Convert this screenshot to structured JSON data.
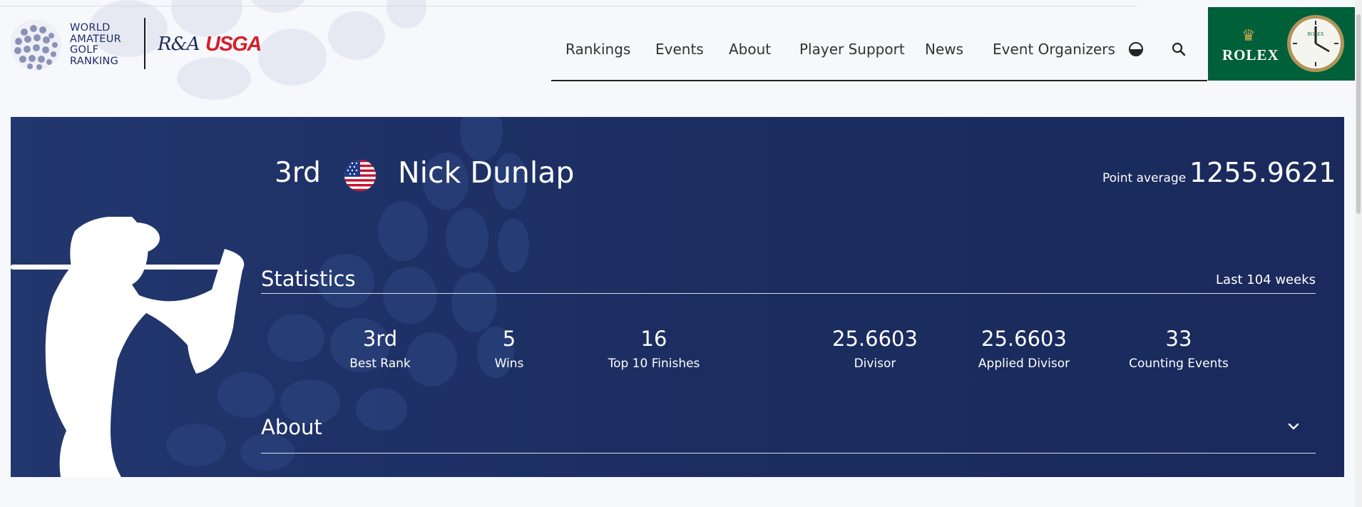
{
  "header": {
    "logo_lines": [
      "WORLD",
      "AMATEUR",
      "GOLF",
      "RANKING"
    ],
    "ra_logo": "R&A",
    "usga_logo": "USGA",
    "nav": [
      "Rankings",
      "Events",
      "About",
      "Player Support",
      "News",
      "Event Organizers"
    ],
    "sponsor": "ROLEX",
    "clock_brand": "ROLEX"
  },
  "player": {
    "rank": "3rd",
    "country_flag": "usa-flag",
    "name": "Nick Dunlap",
    "point_average_label": "Point average",
    "point_average": "1255.9621"
  },
  "statistics": {
    "title": "Statistics",
    "period": "Last 104 weeks",
    "items": [
      {
        "value": "3rd",
        "label": "Best Rank"
      },
      {
        "value": "5",
        "label": "Wins"
      },
      {
        "value": "16",
        "label": "Top 10 Finishes"
      },
      {
        "value": "25.6603",
        "label": "Divisor"
      },
      {
        "value": "25.6603",
        "label": "Applied Divisor"
      },
      {
        "value": "33",
        "label": "Counting Events"
      }
    ]
  },
  "about": {
    "title": "About"
  },
  "colors": {
    "banner": "#1e3166",
    "rolex_green": "#006039",
    "usga_red": "#d41f2c"
  },
  "icons": [
    "theme-toggle-icon",
    "search-icon",
    "chevron-down-icon"
  ]
}
